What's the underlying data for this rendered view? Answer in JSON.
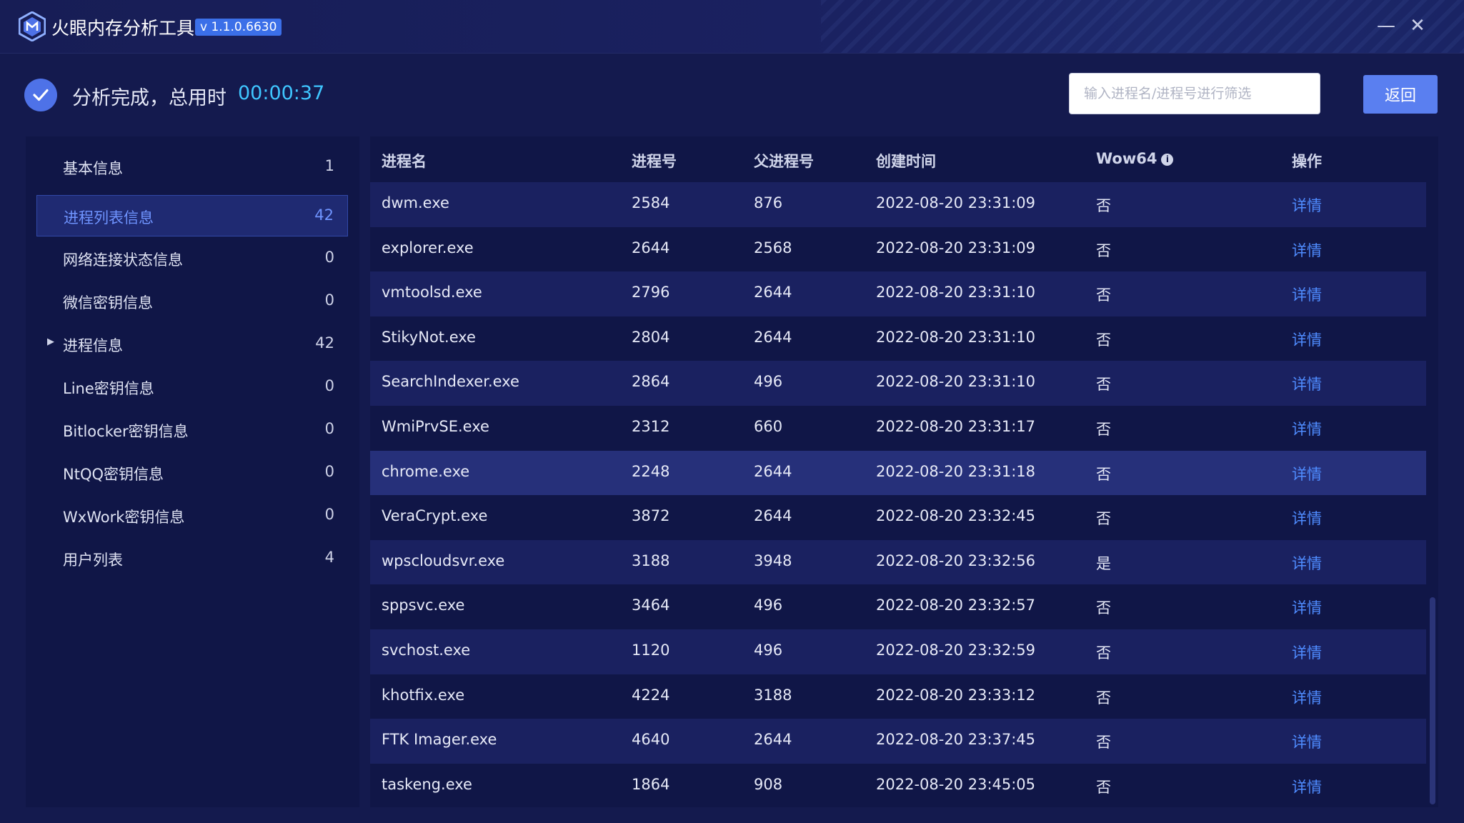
{
  "app": {
    "title": "火眼内存分析工具",
    "version": "v 1.1.0.6630",
    "minimize_icon": "minimize-icon",
    "close_icon": "close-icon"
  },
  "status": {
    "text": "分析完成，总用时",
    "time": "00:00:37"
  },
  "search": {
    "placeholder": "输入进程名/进程号进行筛选",
    "value": ""
  },
  "back_label": "返回",
  "sidebar": {
    "items": [
      {
        "label": "基本信息",
        "count": "1"
      },
      {
        "label": "进程列表信息",
        "count": "42"
      },
      {
        "label": "网络连接状态信息",
        "count": "0"
      },
      {
        "label": "微信密钥信息",
        "count": "0"
      },
      {
        "label": "进程信息",
        "count": "42"
      },
      {
        "label": "Line密钥信息",
        "count": "0"
      },
      {
        "label": "Bitlocker密钥信息",
        "count": "0"
      },
      {
        "label": "NtQQ密钥信息",
        "count": "0"
      },
      {
        "label": "WxWork密钥信息",
        "count": "0"
      },
      {
        "label": "用户列表",
        "count": "4"
      }
    ]
  },
  "table": {
    "columns": [
      "进程名",
      "进程号",
      "父进程号",
      "创建时间",
      "Wow64",
      "操作"
    ],
    "rows": [
      {
        "name": "dwm.exe",
        "pid": "2584",
        "ppid": "876",
        "time": "2022-08-20 23:31:09",
        "wow64": "否",
        "action": "详情"
      },
      {
        "name": "explorer.exe",
        "pid": "2644",
        "ppid": "2568",
        "time": "2022-08-20 23:31:09",
        "wow64": "否",
        "action": "详情"
      },
      {
        "name": "vmtoolsd.exe",
        "pid": "2796",
        "ppid": "2644",
        "time": "2022-08-20 23:31:10",
        "wow64": "否",
        "action": "详情"
      },
      {
        "name": "StikyNot.exe",
        "pid": "2804",
        "ppid": "2644",
        "time": "2022-08-20 23:31:10",
        "wow64": "否",
        "action": "详情"
      },
      {
        "name": "SearchIndexer.exe",
        "pid": "2864",
        "ppid": "496",
        "time": "2022-08-20 23:31:10",
        "wow64": "否",
        "action": "详情"
      },
      {
        "name": "WmiPrvSE.exe",
        "pid": "2312",
        "ppid": "660",
        "time": "2022-08-20 23:31:17",
        "wow64": "否",
        "action": "详情"
      },
      {
        "name": "chrome.exe",
        "pid": "2248",
        "ppid": "2644",
        "time": "2022-08-20 23:31:18",
        "wow64": "否",
        "action": "详情"
      },
      {
        "name": "VeraCrypt.exe",
        "pid": "3872",
        "ppid": "2644",
        "time": "2022-08-20 23:32:45",
        "wow64": "否",
        "action": "详情"
      },
      {
        "name": "wpscloudsvr.exe",
        "pid": "3188",
        "ppid": "3948",
        "time": "2022-08-20 23:32:56",
        "wow64": "是",
        "action": "详情"
      },
      {
        "name": "sppsvc.exe",
        "pid": "3464",
        "ppid": "496",
        "time": "2022-08-20 23:32:57",
        "wow64": "否",
        "action": "详情"
      },
      {
        "name": "svchost.exe",
        "pid": "1120",
        "ppid": "496",
        "time": "2022-08-20 23:32:59",
        "wow64": "否",
        "action": "详情"
      },
      {
        "name": "khotfix.exe",
        "pid": "4224",
        "ppid": "3188",
        "time": "2022-08-20 23:33:12",
        "wow64": "否",
        "action": "详情"
      },
      {
        "name": "FTK Imager.exe",
        "pid": "4640",
        "ppid": "2644",
        "time": "2022-08-20 23:37:45",
        "wow64": "否",
        "action": "详情"
      },
      {
        "name": "taskeng.exe",
        "pid": "1864",
        "ppid": "908",
        "time": "2022-08-20 23:45:05",
        "wow64": "否",
        "action": "详情"
      }
    ]
  },
  "colors": {
    "accent": "#5a7ff0",
    "link": "#4f8cff",
    "time": "#3fc6ff",
    "background": "#141a4e"
  }
}
